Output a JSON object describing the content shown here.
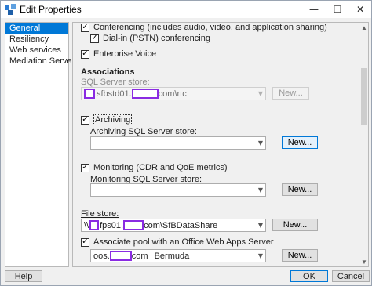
{
  "window": {
    "title": "Edit Properties",
    "minimize": "—",
    "maximize": "☐",
    "close": "✕"
  },
  "nav": {
    "items": [
      {
        "label": "General",
        "selected": true
      },
      {
        "label": "Resiliency",
        "selected": false
      },
      {
        "label": "Web services",
        "selected": false
      },
      {
        "label": "Mediation Server",
        "selected": false
      }
    ]
  },
  "panel": {
    "conferencing": {
      "label": "Conferencing (includes audio, video, and application sharing)",
      "checked": true
    },
    "dialin": {
      "label": "Dial-in (PSTN) conferencing",
      "checked": true
    },
    "enterprise_voice": {
      "label": "Enterprise Voice",
      "checked": true
    },
    "associations_heading": "Associations",
    "sql_store_label": "SQL Server store:",
    "sql_store_value_a": "sfbstd01.",
    "sql_store_value_b": "com\\rtc",
    "sql_new": "New...",
    "archiving": {
      "label": "Archiving",
      "checked": true
    },
    "archiving_store_label": "Archiving SQL Server store:",
    "archiving_store_value": "",
    "archiving_new": "New...",
    "monitoring": {
      "label": "Monitoring (CDR and QoE metrics)",
      "checked": true
    },
    "monitoring_store_label": "Monitoring SQL Server store:",
    "monitoring_store_value": "",
    "monitoring_new": "New...",
    "file_store_label": "File store:",
    "file_store_prefix": "\\\\",
    "file_store_value_a": "fps01.",
    "file_store_value_b": "com\\SfBDataShare",
    "file_new": "New...",
    "owas": {
      "label": "Associate pool with an Office Web Apps Server",
      "checked": true
    },
    "owas_value_a": "oos.",
    "owas_value_b": "com",
    "owas_site": "Bermuda",
    "owas_new": "New..."
  },
  "footer": {
    "help": "Help",
    "ok": "OK",
    "cancel": "Cancel"
  },
  "colors": {
    "accent": "#0078d7",
    "redaction": "#8a2be2"
  }
}
